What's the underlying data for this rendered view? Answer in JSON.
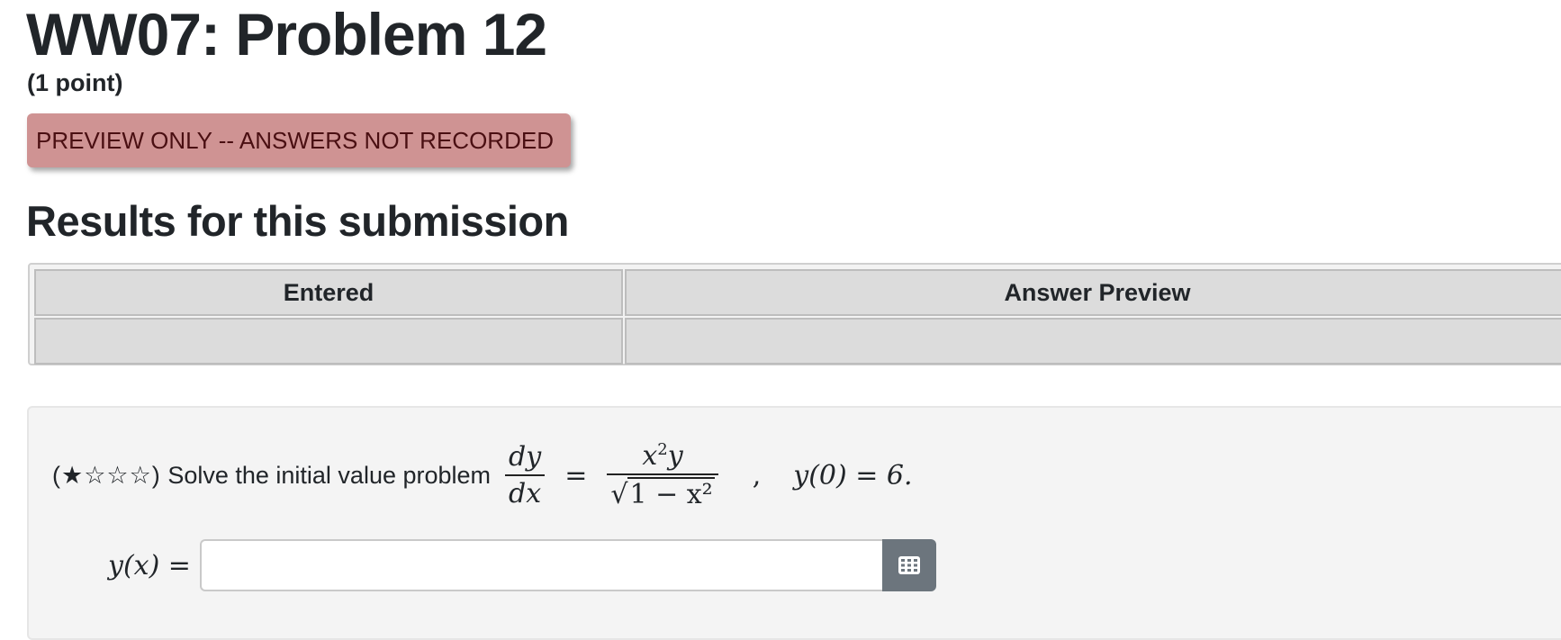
{
  "header": {
    "title": "WW07: Problem 12",
    "points": "(1 point)"
  },
  "banner": {
    "text": "PREVIEW ONLY -- ANSWERS NOT RECORDED",
    "bg_color": "#cf9393",
    "text_color": "#4a0f12"
  },
  "results": {
    "heading": "Results for this submission",
    "columns": [
      "Entered",
      "Answer Preview"
    ],
    "row": [
      "",
      ""
    ]
  },
  "problem": {
    "stars": "(★☆☆☆)",
    "prompt": "Solve the initial value problem",
    "eq_num": "dy",
    "eq_den": "dx",
    "equals": "=",
    "rhs_num_base": "x",
    "rhs_num_exp": "2",
    "rhs_num_tail": "y",
    "rhs_den_pre": "√",
    "rhs_den_rad": "1 − x²",
    "separator": ",",
    "initial_condition": "y(0) = 6."
  },
  "answer": {
    "label": "y(x) =",
    "value": "",
    "placeholder": "",
    "keyboard_icon": "keyboard-icon"
  }
}
